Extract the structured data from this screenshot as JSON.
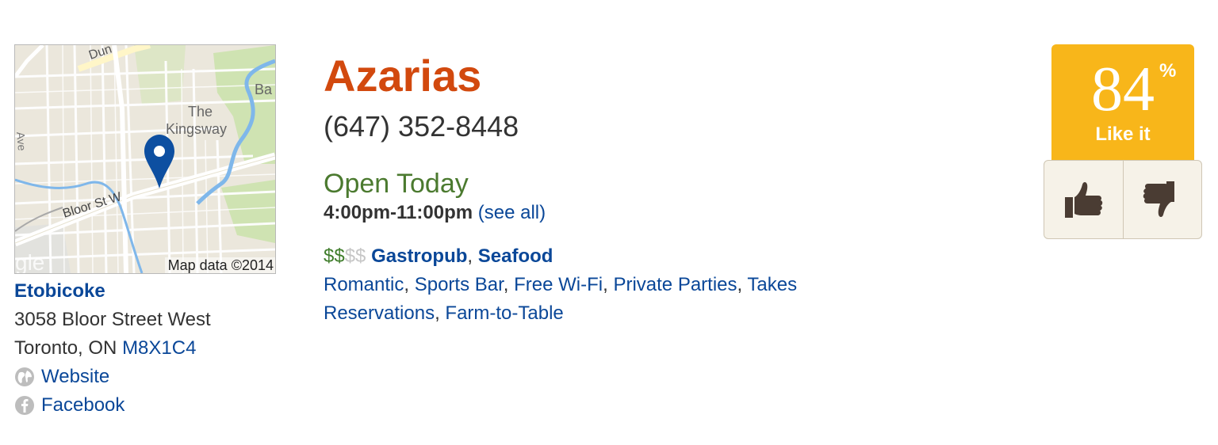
{
  "listing": {
    "name": "Azarias",
    "phone": "(647) 352-8448",
    "open_status": "Open Today",
    "hours": "4:00pm-11:00pm",
    "see_all": "(see all)",
    "price_filled": "$$",
    "price_empty": "$$",
    "categories": [
      "Gastropub",
      "Seafood"
    ],
    "features": [
      "Romantic",
      "Sports Bar",
      "Free Wi-Fi",
      "Private Parties",
      "Takes Reservations",
      "Farm-to-Table"
    ]
  },
  "map": {
    "attribution": "Map data ©2014",
    "labels": {
      "street_top": "Dun",
      "place1": "The",
      "place2": "Kingsway",
      "partial": "Ba",
      "bloor": "Bloor St W",
      "ave": "Ave",
      "google_partial": "gle"
    },
    "colors": {
      "land": "#ebe7dc",
      "park": "#cfe3b2",
      "water": "#7fb7ea",
      "road": "#ffffff",
      "pin": "#0d4fa1"
    }
  },
  "location": {
    "neighborhood": "Etobicoke",
    "street": "3058 Bloor Street West",
    "city_prov": "Toronto, ON",
    "postal": "M8X1C4",
    "website_label": "Website",
    "facebook_label": "Facebook"
  },
  "rating": {
    "score": "84",
    "percent_sign": "%",
    "label": "Like it",
    "color": "#f8b61a",
    "thumbs_up_icon": "thumbs-up-icon",
    "thumbs_down_icon": "thumbs-down-icon"
  },
  "colors": {
    "title": "#d2490e",
    "link": "#0a4798",
    "open": "#4b7a2f"
  }
}
